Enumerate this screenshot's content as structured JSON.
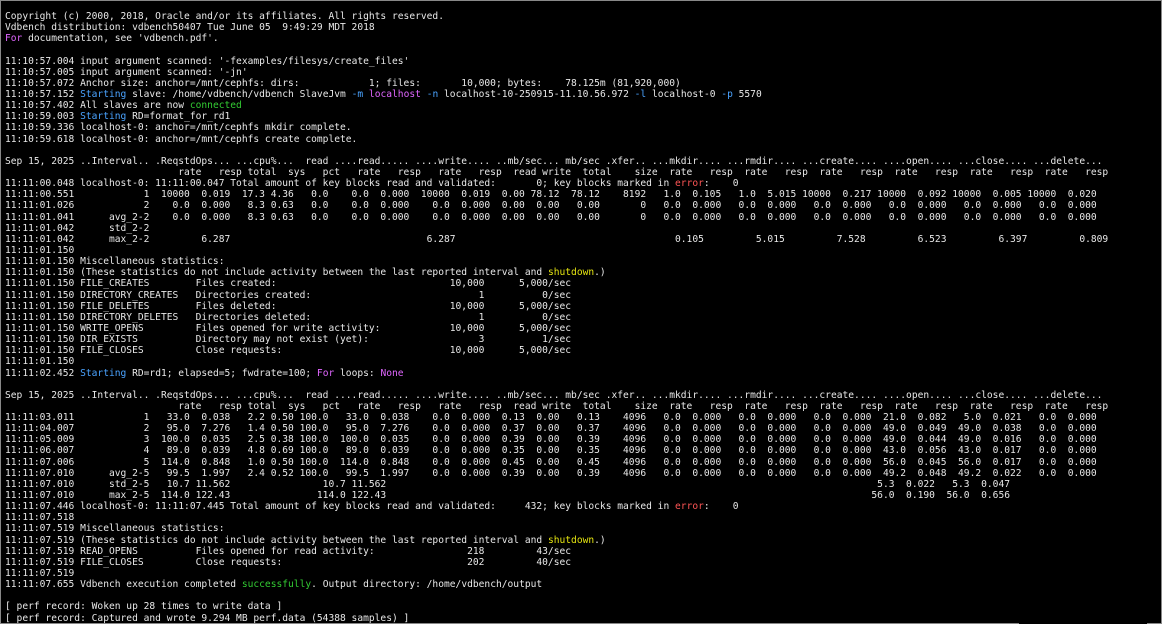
{
  "terminal": {
    "lines": [
      [
        [
          "Copyright (c) 2000, 2018, Oracle and/or its affiliates. All rights reserved.",
          "b"
        ]
      ],
      [
        [
          "Vdbench distribution: vdbench50407 Tue June 05  9:49:29 MDT 2018",
          "b"
        ]
      ],
      [
        [
          "For",
          "mag"
        ],
        [
          " documentation, see 'vdbench.pdf'.",
          "b"
        ]
      ],
      [
        [
          "",
          "b"
        ]
      ],
      [
        [
          "11:10:57.004 input argument scanned: ",
          "b"
        ],
        [
          "'-fexamples/filesys/create_files'",
          "b"
        ]
      ],
      [
        [
          "11:10:57.005 input argument scanned: ",
          "b"
        ],
        [
          "'-jn'",
          "b"
        ]
      ],
      [
        [
          "11:10:57.072 Anchor size: anchor=/mnt/cephfs: dirs:            1; files:       10,000; bytes:    78.125m (81,920,000)",
          "b"
        ]
      ],
      [
        [
          "11:10:57.152 ",
          "b"
        ],
        [
          "Starting",
          "blue"
        ],
        [
          " slave: /home/vdbench/vdbench SlaveJvm ",
          "b"
        ],
        [
          "-m",
          "blue"
        ],
        [
          " ",
          "b"
        ],
        [
          "localhost",
          "mag"
        ],
        [
          " ",
          "b"
        ],
        [
          "-n",
          "blue"
        ],
        [
          " localhost-10-250915-11.10.56.972 ",
          "b"
        ],
        [
          "-l",
          "blue"
        ],
        [
          " localhost-0 ",
          "b"
        ],
        [
          "-p",
          "blue"
        ],
        [
          " 5570",
          "b"
        ]
      ],
      [
        [
          "11:10:57.402 All slaves are now ",
          "b"
        ],
        [
          "connected",
          "green"
        ]
      ],
      [
        [
          "11:10:59.003 ",
          "b"
        ],
        [
          "Starting",
          "blue"
        ],
        [
          " RD=format_for_rd1",
          "b"
        ]
      ],
      [
        [
          "11:10:59.336 localhost-0: anchor=/mnt/cephfs mkdir complete.",
          "b"
        ]
      ],
      [
        [
          "11:10:59.618 localhost-0: anchor=/mnt/cephfs create complete.",
          "b"
        ]
      ],
      [
        [
          "",
          "b"
        ]
      ],
      [
        [
          "Sep 15, 2025 ..Interval.. .ReqstdOps... ...cpu%...  read ....read..... ....write.... ..mb/sec... mb/sec .xfer.. ...mkdir.... ...rmdir.... ...create.... ....open.... ...close.... ...delete...",
          "b"
        ]
      ],
      [
        [
          "                              rate   resp total  sys   pct   rate   resp   rate   resp  read write  total    size  rate   resp  rate   resp  rate   resp  rate   resp  rate   resp  rate   resp",
          "b"
        ]
      ],
      [
        [
          "11:11:00.048 localhost-0: 11:11:00.047 Total amount of key blocks read and validated:       0; key blocks marked in ",
          "b"
        ],
        [
          "error",
          "red"
        ],
        [
          ":    0",
          "b"
        ]
      ],
      [
        [
          "11:11:00.551            1  10000  0.019  17.3 4.36   0.0    0.0  0.000  10000  0.019  0.00 78.12  78.12    8192   1.0  0.105   1.0  5.015 10000  0.217 10000  0.092 10000  0.005 10000  0.020",
          "b"
        ]
      ],
      [
        [
          "11:11:01.026            2    0.0  0.000   8.3 0.63   0.0    0.0  0.000    0.0  0.000  0.00  0.00   0.00       0   0.0  0.000   0.0  0.000   0.0  0.000   0.0  0.000   0.0  0.000   0.0  0.000",
          "b"
        ]
      ],
      [
        [
          "11:11:01.041      avg_2-2    0.0  0.000   8.3 0.63   0.0    0.0  0.000    0.0  0.000  0.00  0.00   0.00       0   0.0  0.000   0.0  0.000   0.0  0.000   0.0  0.000   0.0  0.000   0.0  0.000",
          "b"
        ]
      ],
      [
        [
          "11:11:01.042      std_2-2",
          "b"
        ]
      ],
      [
        [
          "11:11:01.042      max_2-2         6.287                                  6.287                                      0.105         5.015         7.528         6.523         6.397         0.809",
          "b"
        ]
      ],
      [
        [
          "11:11:01.150",
          "b"
        ]
      ],
      [
        [
          "11:11:01.150 Miscellaneous statistics:",
          "b"
        ]
      ],
      [
        [
          "11:11:01.150 (These statistics do not include activity between the last reported interval and ",
          "b"
        ],
        [
          "shutdown",
          "yellow"
        ],
        [
          ".)",
          "b"
        ]
      ],
      [
        [
          "11:11:01.150 FILE_CREATES        Files created:                              10,000      5,000/sec",
          "b"
        ]
      ],
      [
        [
          "11:11:01.150 DIRECTORY_CREATES   Directories created:                             1          0/sec",
          "b"
        ]
      ],
      [
        [
          "11:11:01.150 FILE_DELETES        Files deleted:                              10,000      5,000/sec",
          "b"
        ]
      ],
      [
        [
          "11:11:01.150 DIRECTORY_DELETES   Directories deleted:                             1          0/sec",
          "b"
        ]
      ],
      [
        [
          "11:11:01.150 WRITE_OPENS         Files opened for write activity:            10,000      5,000/sec",
          "b"
        ]
      ],
      [
        [
          "11:11:01.150 DIR_EXISTS          Directory may not exist (yet):                   3          1/sec",
          "b"
        ]
      ],
      [
        [
          "11:11:01.150 FILE_CLOSES         Close requests:                             10,000      5,000/sec",
          "b"
        ]
      ],
      [
        [
          "11:11:01.150",
          "b"
        ]
      ],
      [
        [
          "11:11:02.452 ",
          "b"
        ],
        [
          "Starting",
          "blue"
        ],
        [
          " RD=rd1; elapsed=5; fwdrate=100; ",
          "b"
        ],
        [
          "For",
          "mag"
        ],
        [
          " loops: ",
          "b"
        ],
        [
          "None",
          "mag"
        ]
      ],
      [
        [
          "",
          "b"
        ]
      ],
      [
        [
          "Sep 15, 2025 ..Interval.. .ReqstdOps... ...cpu%...  read ....read..... ....write.... ..mb/sec... mb/sec .xfer.. ...mkdir.... ...rmdir.... ...create.... ....open.... ...close.... ...delete...",
          "b"
        ]
      ],
      [
        [
          "                              rate   resp total  sys   pct   rate   resp   rate   resp  read write  total    size  rate   resp  rate   resp  rate   resp  rate   resp  rate   resp  rate   resp",
          "b"
        ]
      ],
      [
        [
          "11:11:03.011            1   33.0  0.038   2.2 0.50 100.0   33.0  0.038    0.0  0.000  0.13  0.00   0.13    4096   0.0  0.000   0.0  0.000   0.0  0.000  21.0  0.082   5.0  0.021   0.0  0.000",
          "b"
        ]
      ],
      [
        [
          "11:11:04.007            2   95.0  7.276   1.4 0.50 100.0   95.0  7.276    0.0  0.000  0.37  0.00   0.37    4096   0.0  0.000   0.0  0.000   0.0  0.000  49.0  0.049  49.0  0.038   0.0  0.000",
          "b"
        ]
      ],
      [
        [
          "11:11:05.009            3  100.0  0.035   2.5 0.38 100.0  100.0  0.035    0.0  0.000  0.39  0.00   0.39    4096   0.0  0.000   0.0  0.000   0.0  0.000  49.0  0.044  49.0  0.016   0.0  0.000",
          "b"
        ]
      ],
      [
        [
          "11:11:06.007            4   89.0  0.039   4.8 0.69 100.0   89.0  0.039    0.0  0.000  0.35  0.00   0.35    4096   0.0  0.000   0.0  0.000   0.0  0.000  43.0  0.056  43.0  0.017   0.0  0.000",
          "b"
        ]
      ],
      [
        [
          "11:11:07.006            5  114.0  0.848   1.0 0.50 100.0  114.0  0.848    0.0  0.000  0.45  0.00   0.45    4096   0.0  0.000   0.0  0.000   0.0  0.000  56.0  0.045  56.0  0.017   0.0  0.000",
          "b"
        ]
      ],
      [
        [
          "11:11:07.010      avg_2-5   99.5  1.997   2.4 0.52 100.0   99.5  1.997    0.0  0.000  0.39  0.00   0.39    4096   0.0  0.000   0.0  0.000   0.0  0.000  49.2  0.048  49.2  0.022   0.0  0.000",
          "b"
        ]
      ],
      [
        [
          "11:11:07.010      std_2-5   10.7 11.562                10.7 11.562                                                                                     5.3  0.022   5.3  0.047",
          "b"
        ]
      ],
      [
        [
          "11:11:07.010      max_2-5  114.0 122.43               114.0 122.43                                                                                    56.0  0.190  56.0  0.656",
          "b"
        ]
      ],
      [
        [
          "11:11:07.446 localhost-0: 11:11:07.445 Total amount of key blocks read and validated:     432; key blocks marked in ",
          "b"
        ],
        [
          "error",
          "red"
        ],
        [
          ":    0",
          "b"
        ]
      ],
      [
        [
          "11:11:07.518",
          "b"
        ]
      ],
      [
        [
          "11:11:07.519 Miscellaneous statistics:",
          "b"
        ]
      ],
      [
        [
          "11:11:07.519 (These statistics do not include activity between the last reported interval and ",
          "b"
        ],
        [
          "shutdown",
          "yellow"
        ],
        [
          ".)",
          "b"
        ]
      ],
      [
        [
          "11:11:07.519 READ_OPENS          Files opened for read activity:                218         43/sec",
          "b"
        ]
      ],
      [
        [
          "11:11:07.519 FILE_CLOSES         Close requests:                                202         40/sec",
          "b"
        ]
      ],
      [
        [
          "11:11:07.519",
          "b"
        ]
      ],
      [
        [
          "11:11:07.655 Vdbench execution completed ",
          "b"
        ],
        [
          "successfully",
          "green"
        ],
        [
          ". Output directory: /home/vdbench/output",
          "b"
        ]
      ],
      [
        [
          "",
          "b"
        ]
      ],
      [
        [
          "[ perf record: Woken up 28 times to write data ]",
          "b"
        ]
      ],
      [
        [
          "[ perf record: Captured and wrote 9.294 MB perf.data (54388 samples) ]",
          "b"
        ]
      ]
    ]
  }
}
